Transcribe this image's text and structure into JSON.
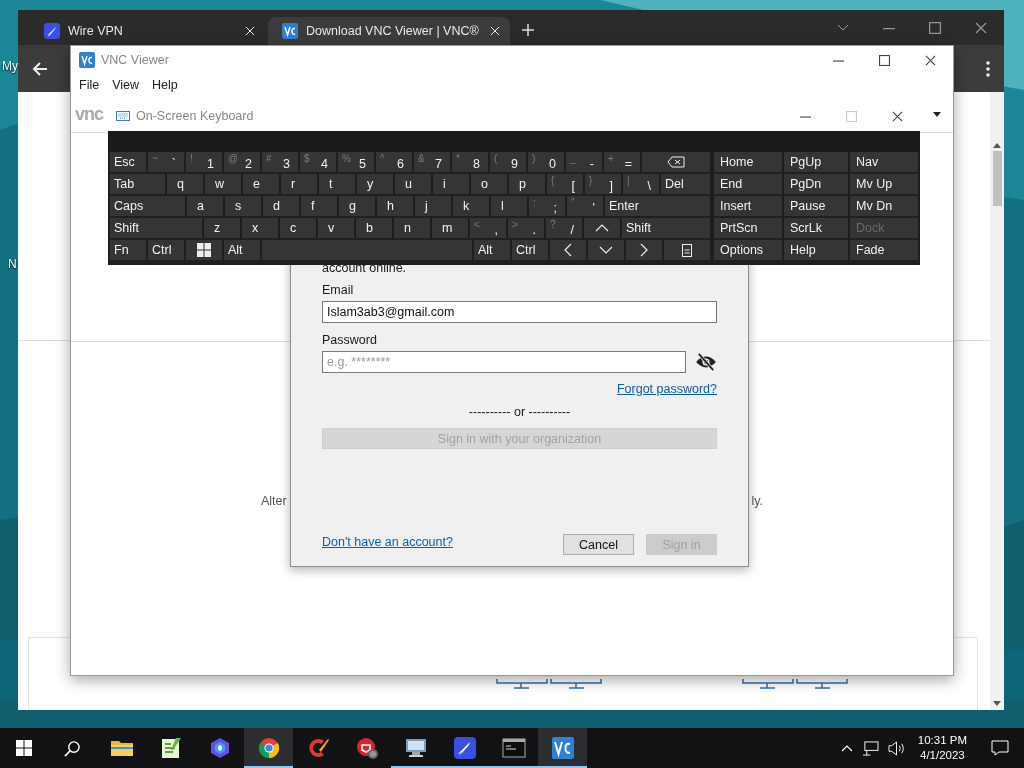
{
  "desktop": {
    "wallpaper": {
      "kind": "picture"
    },
    "icon_labels": [
      "My",
      "N"
    ]
  },
  "browser": {
    "tabs": [
      {
        "title": "Wire VPN",
        "selected": false
      },
      {
        "title": "Download VNC Viewer | VNC®",
        "selected": true
      }
    ]
  },
  "vnc_viewer": {
    "title": "VNC Viewer",
    "menu": [
      "File",
      "View",
      "Help"
    ],
    "logo": "vnc",
    "body_text_left": "Alter",
    "body_text_right": "ly."
  },
  "signin_dialog": {
    "intro": "account online.",
    "email": {
      "label": "Email",
      "value": "Islam3ab3@gmail.com"
    },
    "password": {
      "label": "Password",
      "placeholder": "e.g. ********"
    },
    "forgot_link": "Forgot password?",
    "separator": "---------- or ----------",
    "org_button": {
      "label": "Sign in with your organization",
      "disabled": true
    },
    "signup_link": "Don't have an account?",
    "cancel_button": {
      "label": "Cancel",
      "disabled": false
    },
    "signin_button": {
      "label": "Sign in",
      "disabled": true
    }
  },
  "keyboard": {
    "title": "On-Screen Keyboard",
    "rows": [
      [
        {
          "kind": "label",
          "label": "Esc"
        },
        {
          "kind": "char",
          "upper": "~",
          "lower": "`"
        },
        {
          "kind": "char",
          "upper": "!",
          "lower": "1"
        },
        {
          "kind": "char",
          "upper": "@",
          "lower": "2"
        },
        {
          "kind": "char",
          "upper": "#",
          "lower": "3"
        },
        {
          "kind": "char",
          "upper": "$",
          "lower": "4"
        },
        {
          "kind": "char",
          "upper": "%",
          "lower": "5"
        },
        {
          "kind": "char",
          "upper": "^",
          "lower": "6"
        },
        {
          "kind": "char",
          "upper": "&",
          "lower": "7"
        },
        {
          "kind": "char",
          "upper": "*",
          "lower": "8"
        },
        {
          "kind": "char",
          "upper": "(",
          "lower": "9"
        },
        {
          "kind": "char",
          "upper": ")",
          "lower": "0"
        },
        {
          "kind": "char",
          "upper": "_",
          "lower": "-"
        },
        {
          "kind": "char",
          "upper": "+",
          "lower": "="
        },
        {
          "kind": "backspace"
        }
      ],
      [
        {
          "kind": "tab",
          "label": "Tab"
        },
        {
          "kind": "char",
          "lower": "q"
        },
        {
          "kind": "char",
          "lower": "w"
        },
        {
          "kind": "char",
          "lower": "e"
        },
        {
          "kind": "char",
          "lower": "r"
        },
        {
          "kind": "char",
          "lower": "t"
        },
        {
          "kind": "char",
          "lower": "y"
        },
        {
          "kind": "char",
          "lower": "u"
        },
        {
          "kind": "char",
          "lower": "i"
        },
        {
          "kind": "char",
          "lower": "o"
        },
        {
          "kind": "char",
          "lower": "p"
        },
        {
          "kind": "char",
          "upper": "{",
          "lower": "["
        },
        {
          "kind": "char",
          "upper": "}",
          "lower": "]"
        },
        {
          "kind": "char",
          "upper": "|",
          "lower": "\\"
        },
        {
          "kind": "label",
          "label": "Del"
        }
      ],
      [
        {
          "kind": "caps",
          "label": "Caps"
        },
        {
          "kind": "char",
          "lower": "a"
        },
        {
          "kind": "char",
          "lower": "s"
        },
        {
          "kind": "char",
          "lower": "d"
        },
        {
          "kind": "char",
          "lower": "f"
        },
        {
          "kind": "char",
          "lower": "g"
        },
        {
          "kind": "char",
          "lower": "h"
        },
        {
          "kind": "char",
          "lower": "j"
        },
        {
          "kind": "char",
          "lower": "k"
        },
        {
          "kind": "char",
          "lower": "l"
        },
        {
          "kind": "char",
          "upper": ":",
          "lower": ";"
        },
        {
          "kind": "char",
          "upper": "\"",
          "lower": "'"
        },
        {
          "kind": "label",
          "label": "Enter"
        }
      ],
      [
        {
          "kind": "shift",
          "label": "Shift"
        },
        {
          "kind": "char",
          "lower": "z"
        },
        {
          "kind": "char",
          "lower": "x"
        },
        {
          "kind": "char",
          "lower": "c"
        },
        {
          "kind": "char",
          "lower": "v"
        },
        {
          "kind": "char",
          "lower": "b"
        },
        {
          "kind": "char",
          "lower": "n"
        },
        {
          "kind": "char",
          "lower": "m"
        },
        {
          "kind": "char",
          "upper": "<",
          "lower": ","
        },
        {
          "kind": "char",
          "upper": ">",
          "lower": "."
        },
        {
          "kind": "char",
          "upper": "?",
          "lower": "/"
        },
        {
          "kind": "arrow-up"
        },
        {
          "kind": "shift",
          "label": "Shift"
        }
      ],
      [
        {
          "kind": "label",
          "label": "Fn"
        },
        {
          "kind": "label",
          "label": "Ctrl"
        },
        {
          "kind": "win"
        },
        {
          "kind": "label",
          "label": "Alt"
        },
        {
          "kind": "space"
        },
        {
          "kind": "label",
          "label": "Alt"
        },
        {
          "kind": "label",
          "label": "Ctrl"
        },
        {
          "kind": "arrow-left"
        },
        {
          "kind": "arrow-down"
        },
        {
          "kind": "arrow-right"
        },
        {
          "kind": "menu"
        }
      ]
    ],
    "nav_keys": [
      {
        "label": "Home",
        "disabled": false
      },
      {
        "label": "PgUp",
        "disabled": false
      },
      {
        "label": "Nav",
        "disabled": false
      },
      {
        "label": "End",
        "disabled": false
      },
      {
        "label": "PgDn",
        "disabled": false
      },
      {
        "label": "Mv Up",
        "disabled": false
      },
      {
        "label": "Insert",
        "disabled": false
      },
      {
        "label": "Pause",
        "disabled": false
      },
      {
        "label": "Mv Dn",
        "disabled": false
      },
      {
        "label": "PrtScn",
        "disabled": false
      },
      {
        "label": "ScrLk",
        "disabled": false
      },
      {
        "label": "Dock",
        "disabled": true
      },
      {
        "label": "Options",
        "disabled": false
      },
      {
        "label": "Help",
        "disabled": false
      },
      {
        "label": "Fade",
        "disabled": false
      }
    ]
  },
  "taskbar": {
    "apps": [
      {
        "kind": "folder",
        "running": false,
        "highlighted": false
      },
      {
        "kind": "notepad",
        "running": false,
        "highlighted": false
      },
      {
        "kind": "ribbon",
        "running": false,
        "highlighted": false
      },
      {
        "kind": "circle",
        "running": true,
        "highlighted": true
      },
      {
        "kind": "brush",
        "running": false,
        "highlighted": false
      },
      {
        "kind": "shield",
        "running": false,
        "highlighted": false
      },
      {
        "kind": "computer",
        "running": true,
        "highlighted": false
      },
      {
        "kind": "rocket",
        "running": true,
        "highlighted": false
      },
      {
        "kind": "terminal",
        "running": true,
        "highlighted": false
      },
      {
        "kind": "vnc",
        "running": true,
        "highlighted": true
      }
    ],
    "time": "10:31 PM",
    "date": "4/1/2023"
  }
}
